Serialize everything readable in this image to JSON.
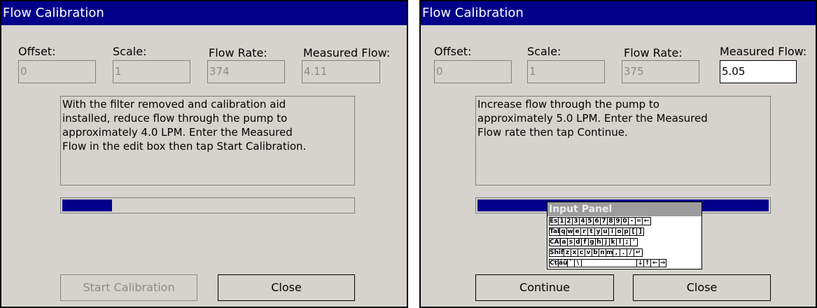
{
  "left": {
    "title": "Flow Calibration",
    "labels": {
      "offset": "Offset:",
      "scale": "Scale:",
      "flow_rate": "Flow Rate:",
      "measured_flow": "Measured Flow:"
    },
    "values": {
      "offset": "0",
      "scale": "1",
      "flow_rate": "374",
      "measured_flow": "4.11"
    },
    "message": "With the filter removed and calibration aid\ninstalled, reduce flow through the pump to\napproximately  4.0 LPM.  Enter the Measured\nFlow in the edit box then tap Start Calibration.",
    "progress": 0.17,
    "buttons": {
      "primary": "Start Calibration",
      "close": "Close"
    }
  },
  "right": {
    "title": "Flow Calibration",
    "labels": {
      "offset": "Offset:",
      "scale": "Scale:",
      "flow_rate": "Flow Rate:",
      "measured_flow": "Measured Flow:"
    },
    "values": {
      "offset": "0",
      "scale": "1",
      "flow_rate": "375",
      "measured_flow": "5.05"
    },
    "message": "Increase flow through the pump to\napproximately  5.0 LPM.  Enter the Measured\nFlow rate then tap Continue.",
    "progress": 1.0,
    "buttons": {
      "primary": "Continue",
      "close": "Close"
    }
  },
  "input_panel": {
    "title": "Input Panel",
    "rows": [
      [
        "Esc",
        "1",
        "2",
        "3",
        "4",
        "5",
        "6",
        "7",
        "8",
        "9",
        "0",
        "-",
        "=",
        "←"
      ],
      [
        "Tab",
        "q",
        "w",
        "e",
        "r",
        "t",
        "y",
        "u",
        "i",
        "o",
        "p",
        "[",
        "]"
      ],
      [
        "CAP",
        "a",
        "s",
        "d",
        "f",
        "g",
        "h",
        "j",
        "k",
        "l",
        ";",
        "'"
      ],
      [
        "Shift",
        "z",
        "x",
        "c",
        "v",
        "b",
        "n",
        "m",
        ",",
        ".",
        "/",
        "↵"
      ],
      [
        "Ctl",
        "áü",
        "`",
        "\\",
        "",
        "↓",
        "↑",
        "←",
        "→"
      ]
    ]
  },
  "colors": {
    "window": "#d6d3ce",
    "titlebar": "#00008b",
    "progress": "#00008b"
  }
}
